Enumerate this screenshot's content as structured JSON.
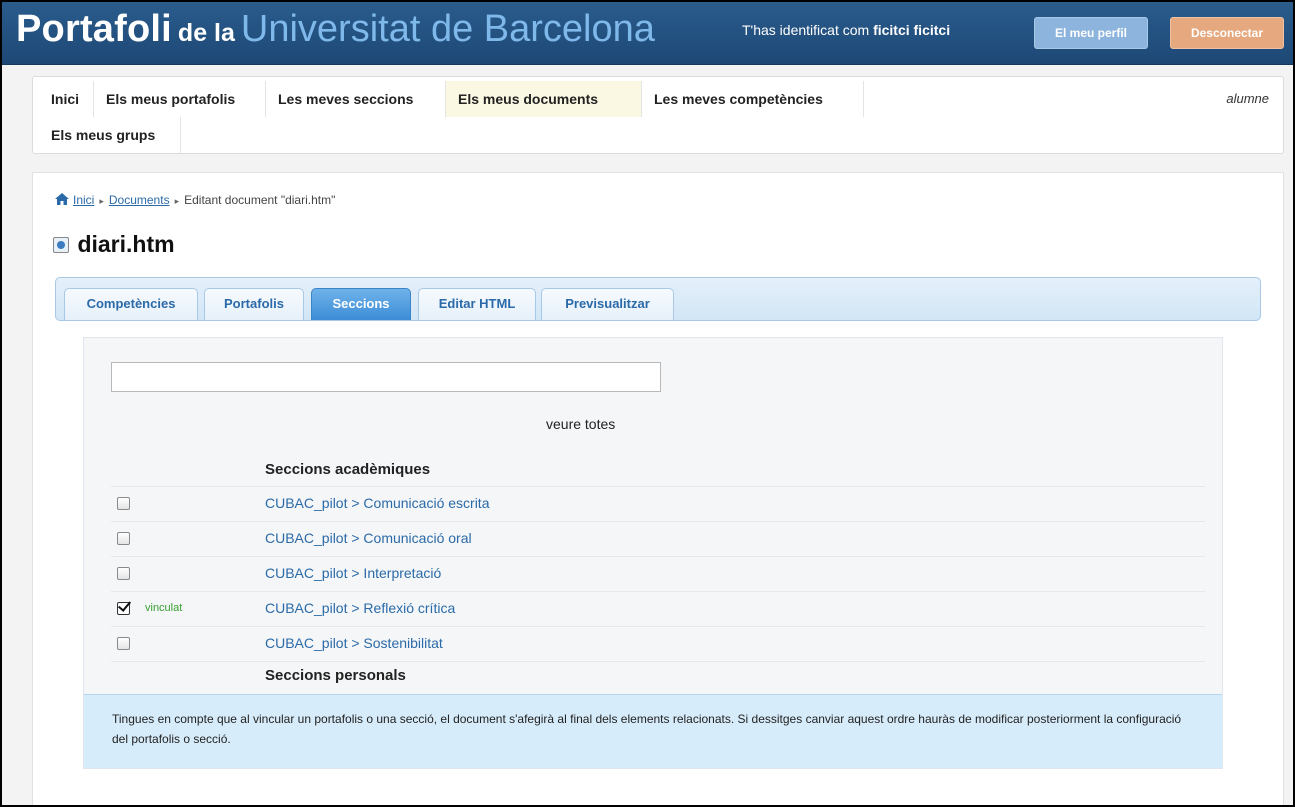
{
  "header": {
    "brand": {
      "part1": "Portafoli",
      "part2": "de la",
      "part3": "Universitat de Barcelona"
    },
    "ident_prefix": "T'has identificat com",
    "user_name": "ficitci ficitci",
    "profile_button": "El meu perfil",
    "logout_button": "Desconectar"
  },
  "nav": {
    "items": [
      {
        "label": "Inici"
      },
      {
        "label": "Els meus portafolis"
      },
      {
        "label": "Les meves seccions"
      },
      {
        "label": "Els meus documents"
      },
      {
        "label": "Les meves competències"
      },
      {
        "label": "Els meus grups"
      }
    ],
    "active_index": 3,
    "role": "alumne"
  },
  "breadcrumb": {
    "home": "Inici",
    "documents": "Documents",
    "current": "Editant document \"diari.htm\""
  },
  "document": {
    "title": "diari.htm"
  },
  "tabs": [
    {
      "label": "Competències"
    },
    {
      "label": "Portafolis"
    },
    {
      "label": "Seccions"
    },
    {
      "label": "Editar HTML"
    },
    {
      "label": "Previsualitzar"
    }
  ],
  "active_tab": 2,
  "sections": {
    "search_value": "",
    "see_all": "veure totes",
    "academic_header": "Seccions acadèmiques",
    "items": [
      {
        "label": "CUBAC_pilot > Comunicació escrita",
        "checked": false,
        "status": ""
      },
      {
        "label": "CUBAC_pilot > Comunicació oral",
        "checked": false,
        "status": ""
      },
      {
        "label": "CUBAC_pilot > Interpretació",
        "checked": false,
        "status": ""
      },
      {
        "label": "CUBAC_pilot > Reflexió crítica",
        "checked": true,
        "status": "vinculat"
      },
      {
        "label": "CUBAC_pilot > Sostenibilitat",
        "checked": false,
        "status": ""
      }
    ],
    "personal_header": "Seccions personals"
  },
  "info_text": "Tingues en compte que al vincular un portafolis o una secció, el document s'afegirà al final dels elements relacionats. Si dessitges canviar aquest ordre hauràs de modificar posteriorment la configuració del portafolis o secció.",
  "colors": {
    "header_bg": "#1d4876",
    "accent_blue": "#2b6aa8",
    "tab_active": "#3c8dd6",
    "linked_green": "#3aa032",
    "info_bg": "#d7ecfa"
  }
}
